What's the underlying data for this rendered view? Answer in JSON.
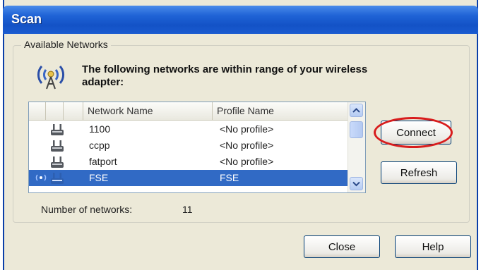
{
  "window": {
    "title": "Scan"
  },
  "group": {
    "label": "Available Networks"
  },
  "heading": "The following networks are within range of your wireless adapter:",
  "table": {
    "columns": [
      "Network Name",
      "Profile Name"
    ],
    "rows": [
      {
        "name": "1100",
        "profile": "<No profile>",
        "selected": false,
        "connected": false
      },
      {
        "name": "ccpp",
        "profile": "<No profile>",
        "selected": false,
        "connected": false
      },
      {
        "name": "fatport",
        "profile": "<No profile>",
        "selected": false,
        "connected": false
      },
      {
        "name": "FSE",
        "profile": "FSE",
        "selected": true,
        "connected": true
      }
    ]
  },
  "buttons": {
    "connect": "Connect",
    "refresh": "Refresh",
    "close": "Close",
    "help": "Help"
  },
  "summary": {
    "label": "Number of networks:",
    "value": "11"
  },
  "icons": {
    "window_icon": "wireless-antenna-icon",
    "row_icon": "wireless-router-icon",
    "signal_icon": "signal-strength-icon"
  },
  "colors": {
    "title_bar": "#1f63d6",
    "selection": "#316ac5",
    "annotation_ring": "#d81d1d"
  }
}
